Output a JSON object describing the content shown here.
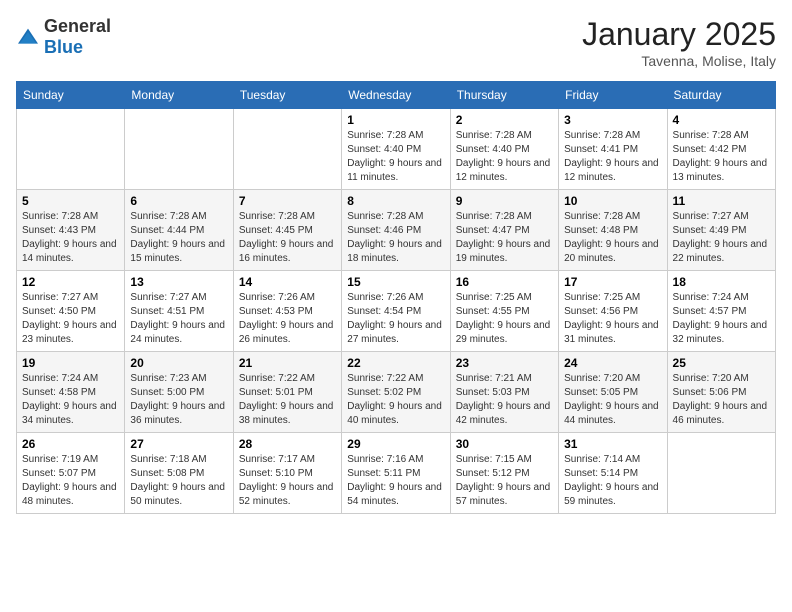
{
  "header": {
    "logo_general": "General",
    "logo_blue": "Blue",
    "month_title": "January 2025",
    "location": "Tavenna, Molise, Italy"
  },
  "weekdays": [
    "Sunday",
    "Monday",
    "Tuesday",
    "Wednesday",
    "Thursday",
    "Friday",
    "Saturday"
  ],
  "weeks": [
    [
      {
        "day": "",
        "sunrise": "",
        "sunset": "",
        "daylight": ""
      },
      {
        "day": "",
        "sunrise": "",
        "sunset": "",
        "daylight": ""
      },
      {
        "day": "",
        "sunrise": "",
        "sunset": "",
        "daylight": ""
      },
      {
        "day": "1",
        "sunrise": "7:28 AM",
        "sunset": "4:40 PM",
        "daylight": "9 hours and 11 minutes."
      },
      {
        "day": "2",
        "sunrise": "7:28 AM",
        "sunset": "4:40 PM",
        "daylight": "9 hours and 12 minutes."
      },
      {
        "day": "3",
        "sunrise": "7:28 AM",
        "sunset": "4:41 PM",
        "daylight": "9 hours and 12 minutes."
      },
      {
        "day": "4",
        "sunrise": "7:28 AM",
        "sunset": "4:42 PM",
        "daylight": "9 hours and 13 minutes."
      }
    ],
    [
      {
        "day": "5",
        "sunrise": "7:28 AM",
        "sunset": "4:43 PM",
        "daylight": "9 hours and 14 minutes."
      },
      {
        "day": "6",
        "sunrise": "7:28 AM",
        "sunset": "4:44 PM",
        "daylight": "9 hours and 15 minutes."
      },
      {
        "day": "7",
        "sunrise": "7:28 AM",
        "sunset": "4:45 PM",
        "daylight": "9 hours and 16 minutes."
      },
      {
        "day": "8",
        "sunrise": "7:28 AM",
        "sunset": "4:46 PM",
        "daylight": "9 hours and 18 minutes."
      },
      {
        "day": "9",
        "sunrise": "7:28 AM",
        "sunset": "4:47 PM",
        "daylight": "9 hours and 19 minutes."
      },
      {
        "day": "10",
        "sunrise": "7:28 AM",
        "sunset": "4:48 PM",
        "daylight": "9 hours and 20 minutes."
      },
      {
        "day": "11",
        "sunrise": "7:27 AM",
        "sunset": "4:49 PM",
        "daylight": "9 hours and 22 minutes."
      }
    ],
    [
      {
        "day": "12",
        "sunrise": "7:27 AM",
        "sunset": "4:50 PM",
        "daylight": "9 hours and 23 minutes."
      },
      {
        "day": "13",
        "sunrise": "7:27 AM",
        "sunset": "4:51 PM",
        "daylight": "9 hours and 24 minutes."
      },
      {
        "day": "14",
        "sunrise": "7:26 AM",
        "sunset": "4:53 PM",
        "daylight": "9 hours and 26 minutes."
      },
      {
        "day": "15",
        "sunrise": "7:26 AM",
        "sunset": "4:54 PM",
        "daylight": "9 hours and 27 minutes."
      },
      {
        "day": "16",
        "sunrise": "7:25 AM",
        "sunset": "4:55 PM",
        "daylight": "9 hours and 29 minutes."
      },
      {
        "day": "17",
        "sunrise": "7:25 AM",
        "sunset": "4:56 PM",
        "daylight": "9 hours and 31 minutes."
      },
      {
        "day": "18",
        "sunrise": "7:24 AM",
        "sunset": "4:57 PM",
        "daylight": "9 hours and 32 minutes."
      }
    ],
    [
      {
        "day": "19",
        "sunrise": "7:24 AM",
        "sunset": "4:58 PM",
        "daylight": "9 hours and 34 minutes."
      },
      {
        "day": "20",
        "sunrise": "7:23 AM",
        "sunset": "5:00 PM",
        "daylight": "9 hours and 36 minutes."
      },
      {
        "day": "21",
        "sunrise": "7:22 AM",
        "sunset": "5:01 PM",
        "daylight": "9 hours and 38 minutes."
      },
      {
        "day": "22",
        "sunrise": "7:22 AM",
        "sunset": "5:02 PM",
        "daylight": "9 hours and 40 minutes."
      },
      {
        "day": "23",
        "sunrise": "7:21 AM",
        "sunset": "5:03 PM",
        "daylight": "9 hours and 42 minutes."
      },
      {
        "day": "24",
        "sunrise": "7:20 AM",
        "sunset": "5:05 PM",
        "daylight": "9 hours and 44 minutes."
      },
      {
        "day": "25",
        "sunrise": "7:20 AM",
        "sunset": "5:06 PM",
        "daylight": "9 hours and 46 minutes."
      }
    ],
    [
      {
        "day": "26",
        "sunrise": "7:19 AM",
        "sunset": "5:07 PM",
        "daylight": "9 hours and 48 minutes."
      },
      {
        "day": "27",
        "sunrise": "7:18 AM",
        "sunset": "5:08 PM",
        "daylight": "9 hours and 50 minutes."
      },
      {
        "day": "28",
        "sunrise": "7:17 AM",
        "sunset": "5:10 PM",
        "daylight": "9 hours and 52 minutes."
      },
      {
        "day": "29",
        "sunrise": "7:16 AM",
        "sunset": "5:11 PM",
        "daylight": "9 hours and 54 minutes."
      },
      {
        "day": "30",
        "sunrise": "7:15 AM",
        "sunset": "5:12 PM",
        "daylight": "9 hours and 57 minutes."
      },
      {
        "day": "31",
        "sunrise": "7:14 AM",
        "sunset": "5:14 PM",
        "daylight": "9 hours and 59 minutes."
      },
      {
        "day": "",
        "sunrise": "",
        "sunset": "",
        "daylight": ""
      }
    ]
  ]
}
